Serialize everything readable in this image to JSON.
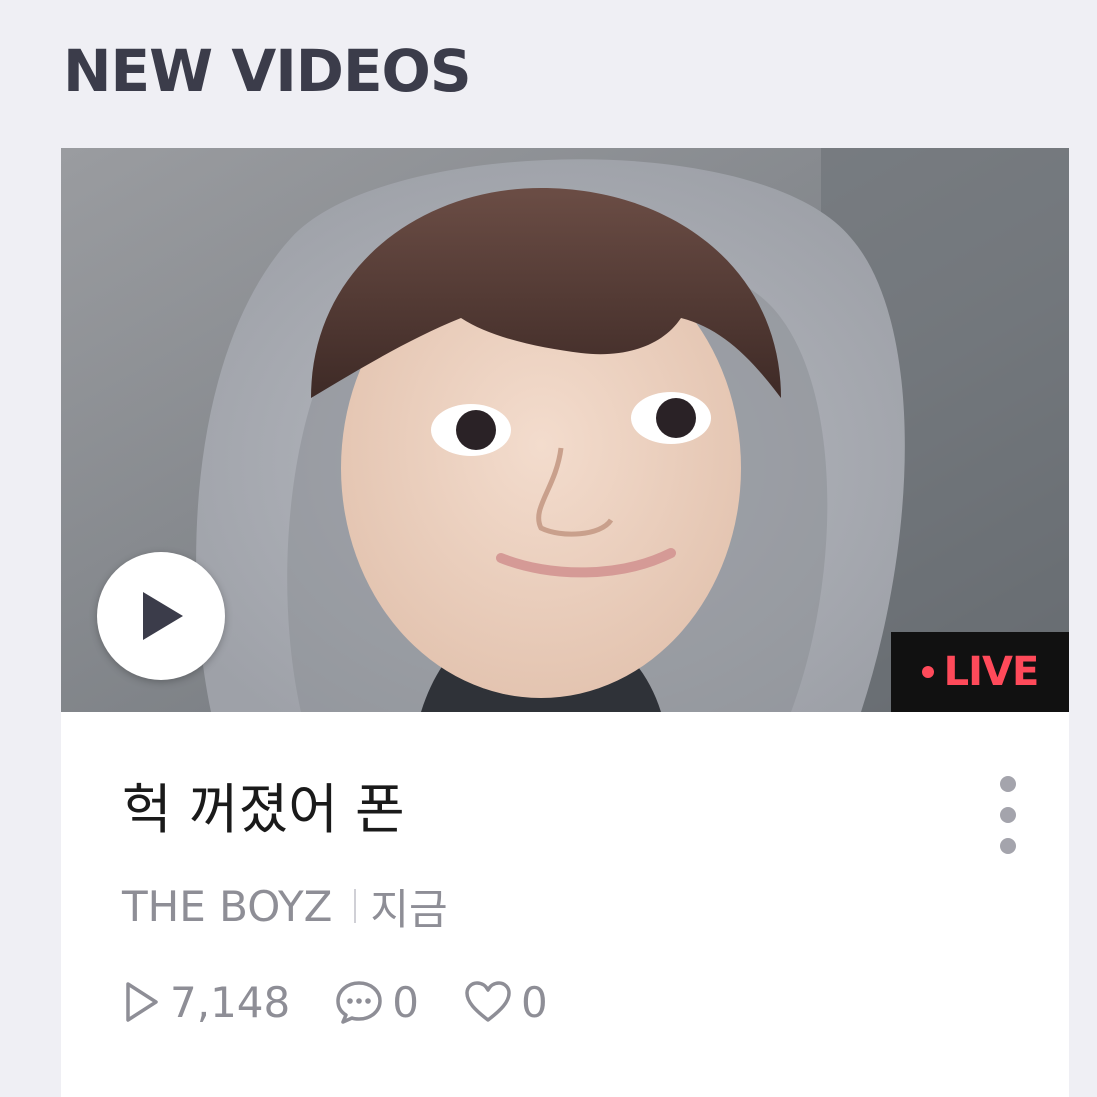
{
  "section": {
    "title": "NEW VIDEOS"
  },
  "video": {
    "badge": "LIVE",
    "title": "헉 꺼졌어 폰",
    "channel": "THE BOYZ",
    "time": "지금",
    "stats": {
      "plays": "7,148",
      "comments": "0",
      "likes": "0"
    },
    "thumbnail": "live-stream-selfie-thumbnail"
  },
  "colors": {
    "background": "#efeff4",
    "title_text": "#3b3c4a",
    "live_accent": "#ff4a5a",
    "badge_bg": "#111111",
    "meta_text": "#8e8e96"
  },
  "icons": {
    "play_button": "play-icon",
    "more": "more-vertical-icon",
    "views": "play-outline-icon",
    "comments": "comment-bubble-icon",
    "likes": "heart-outline-icon"
  }
}
